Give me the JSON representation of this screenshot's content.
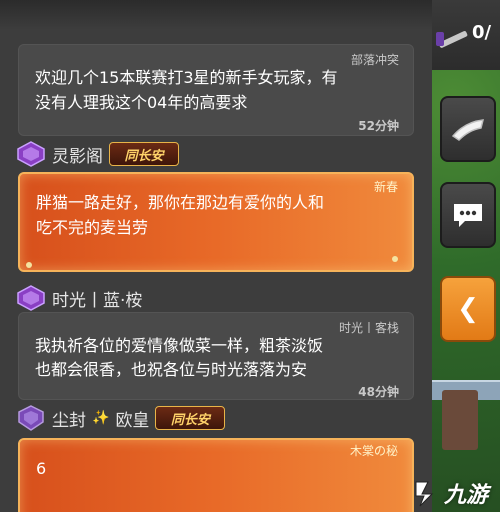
{
  "chat": {
    "messages": [
      {
        "tag": "部落冲突",
        "lines": [
          "欢迎几个15本联赛打3星的新手女玩家，有",
          "没有人理我这个04年的高要求"
        ],
        "time": "52分钟"
      },
      {
        "user": "灵影阁",
        "title_plate": "同长安",
        "lines": [
          "胖猫一路走好，那你在那边有爱你的人和",
          "吃不完的麦当劳"
        ],
        "tag": "新春"
      },
      {
        "user": "时光丨蓝·桉",
        "tag": "时光丨客栈",
        "lines": [
          "我执祈各位的爱情像做菜一样，粗茶淡饭",
          "也都会很香，也祝各位与时光落落为安"
        ],
        "time": "48分钟"
      },
      {
        "user_part1": "尘封",
        "user_sparkle": "✨",
        "user_part2": "欧皇",
        "title_plate": "同长安",
        "tag": "木棠の秘",
        "lines": [
          "6"
        ]
      }
    ]
  },
  "game": {
    "counter": "0/",
    "buttons": [
      "horn-icon",
      "chat-icon",
      "collapse-arrow-icon"
    ],
    "collapse_glyph": "❮"
  },
  "watermark": {
    "text": "九游"
  },
  "colors": {
    "orange_bubble": "#e86a28",
    "dark_bubble": "#4a4a4a",
    "badge_purple": "#8a3fc4"
  }
}
